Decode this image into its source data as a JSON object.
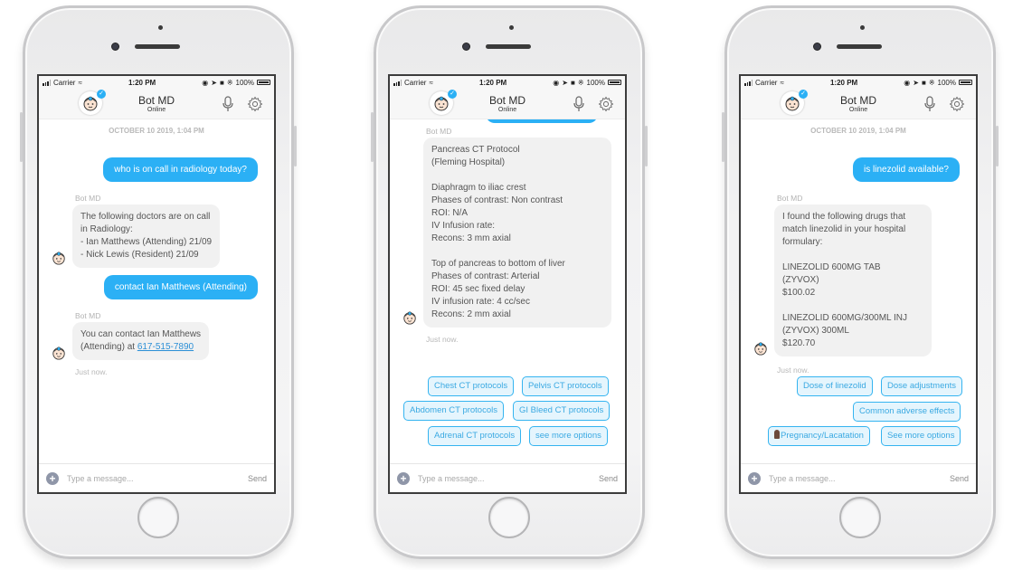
{
  "colors": {
    "accent": "#2bb0f5",
    "user_bubble": "#2bb0f5",
    "bot_bubble": "#f1f1f1",
    "quick_reply_border": "#35b4f0",
    "quick_reply_bg": "#e5f5fd",
    "link": "#2b8fd6"
  },
  "status_bar": {
    "carrier": "Carrier",
    "time": "1:20 PM",
    "battery": "100%"
  },
  "header": {
    "title": "Bot MD",
    "status": "Online",
    "icons": [
      "bot-avatar-icon",
      "verified-check-icon",
      "mic-icon",
      "gear-icon"
    ]
  },
  "composer": {
    "placeholder": "Type a message...",
    "send_label": "Send",
    "plus_icon": "plus-icon"
  },
  "phones": [
    {
      "date_label": "OCTOBER 10 2019, 1:04 PM",
      "messages": [
        {
          "role": "user",
          "text": "who is on call in radiology today?"
        },
        {
          "role": "bot",
          "sender": "Bot MD",
          "text": "The following doctors are on call\nin Radiology:\n- Ian Matthews (Attending) 21/09\n- Nick Lewis (Resident) 21/09"
        },
        {
          "role": "user",
          "text": "contact Ian Matthews (Attending)"
        },
        {
          "role": "bot",
          "sender": "Bot MD",
          "text_before_link": "You can contact Ian Matthews\n(Attending) at ",
          "link": "617-515-7890"
        }
      ],
      "timestamp": "Just now."
    },
    {
      "messages": [
        {
          "role": "bot",
          "sender": "Bot MD",
          "text": "Pancreas CT Protocol\n(Fleming Hospital)\n\nDiaphragm to iliac crest\nPhases of contrast: Non contrast\nROI: N/A\nIV Infusion rate:\nRecons: 3 mm axial\n\nTop of pancreas to bottom of liver\nPhases of contrast: Arterial\nROI: 45 sec fixed delay\nIV infusion rate: 4 cc/sec\nRecons: 2 mm axial"
        }
      ],
      "timestamp": "Just now.",
      "quick_replies": [
        "Chest CT protocols",
        "Pelvis CT protocols",
        "Abdomen CT protocols",
        "GI Bleed CT protocols",
        "Adrenal CT protocols",
        "see more options"
      ]
    },
    {
      "date_label": "OCTOBER 10 2019, 1:04 PM",
      "messages": [
        {
          "role": "user",
          "text": "is linezolid available?"
        },
        {
          "role": "bot",
          "sender": "Bot MD",
          "text": "I found the following drugs that\nmatch linezolid in your hospital\nformulary:\n\nLINEZOLID 600MG TAB\n(ZYVOX)\n$100.02\n\nLINEZOLID 600MG/300ML INJ\n(ZYVOX) 300ML\n$120.70"
        }
      ],
      "timestamp": "Just now.",
      "quick_replies": [
        "Dose of linezolid",
        "Dose adjustments",
        "Common adverse effects",
        "Pregnancy/Lacatation",
        "See more options"
      ],
      "quick_reply_icons": {
        "3": "pregnant-woman-icon"
      }
    }
  ]
}
